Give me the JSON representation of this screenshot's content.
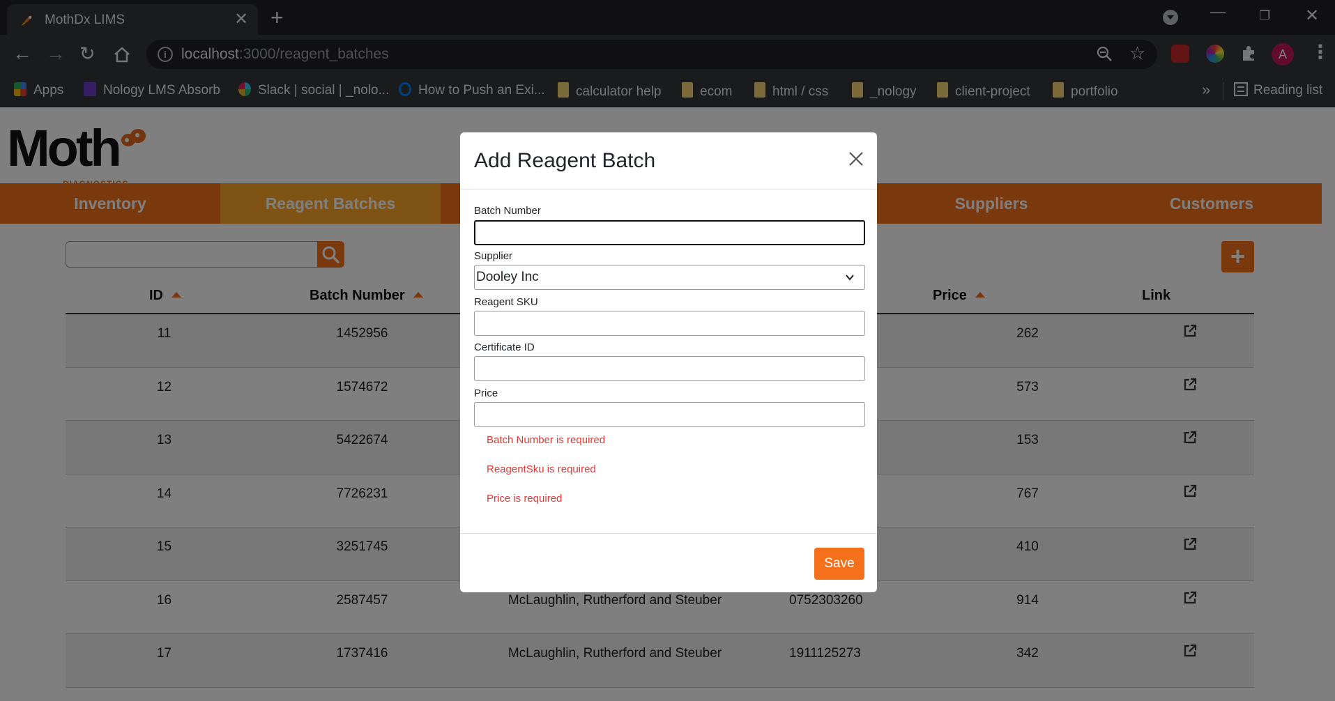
{
  "browser": {
    "tab_title": "MothDx LIMS",
    "tab_close": "✕",
    "new_tab": "+",
    "url_host": "localhost",
    "url_path": ":3000/reagent_batches",
    "avatar_letter": "A",
    "bookmarks": [
      {
        "label": "Apps"
      },
      {
        "label": "Nology LMS Absorb"
      },
      {
        "label": "Slack | social | _nolo..."
      },
      {
        "label": "How to Push an Exi..."
      },
      {
        "label": "calculator help"
      },
      {
        "label": "ecom"
      },
      {
        "label": "html / css"
      },
      {
        "label": "_nology"
      },
      {
        "label": "client-project"
      },
      {
        "label": "portfolio"
      }
    ],
    "bookmarks_overflow": "»",
    "reading_list": "Reading list"
  },
  "logo": {
    "name": "Moth",
    "sub": "DIAGNOSTICS"
  },
  "nav": {
    "items": [
      {
        "label": "Inventory"
      },
      {
        "label": "Reagent Batches"
      },
      {
        "label": ""
      },
      {
        "label": ""
      },
      {
        "label": "Suppliers"
      },
      {
        "label": "Customers"
      }
    ]
  },
  "table": {
    "headers": {
      "id": "ID",
      "batch": "Batch Number",
      "price": "Price",
      "link": "Link"
    },
    "rows": [
      {
        "id": "11",
        "batch": "1452956",
        "supplier": "",
        "sku": "",
        "price": "262"
      },
      {
        "id": "12",
        "batch": "1574672",
        "supplier": "",
        "sku": "",
        "price": "573"
      },
      {
        "id": "13",
        "batch": "5422674",
        "supplier": "",
        "sku": "",
        "price": "153"
      },
      {
        "id": "14",
        "batch": "7726231",
        "supplier": "",
        "sku": "",
        "price": "767"
      },
      {
        "id": "15",
        "batch": "3251745",
        "supplier": "",
        "sku": "",
        "price": "410"
      },
      {
        "id": "16",
        "batch": "2587457",
        "supplier": "McLaughlin, Rutherford and Steuber",
        "sku": "0752303260",
        "price": "914"
      },
      {
        "id": "17",
        "batch": "1737416",
        "supplier": "McLaughlin, Rutherford and Steuber",
        "sku": "1911125273",
        "price": "342"
      }
    ]
  },
  "modal": {
    "title": "Add Reagent Batch",
    "fields": {
      "batch_label": "Batch Number",
      "batch_value": "",
      "supplier_label": "Supplier",
      "supplier_value": "Dooley Inc",
      "sku_label": "Reagent SKU",
      "sku_value": "",
      "cert_label": "Certificate ID",
      "cert_value": "",
      "price_label": "Price",
      "price_value": ""
    },
    "errors": [
      "Batch Number is required",
      "ReagentSku is required",
      "Price is required"
    ],
    "save_label": "Save"
  },
  "colors": {
    "brand_orange": "#f4701a",
    "active_tab": "#ffa726",
    "error": "#e53935"
  }
}
